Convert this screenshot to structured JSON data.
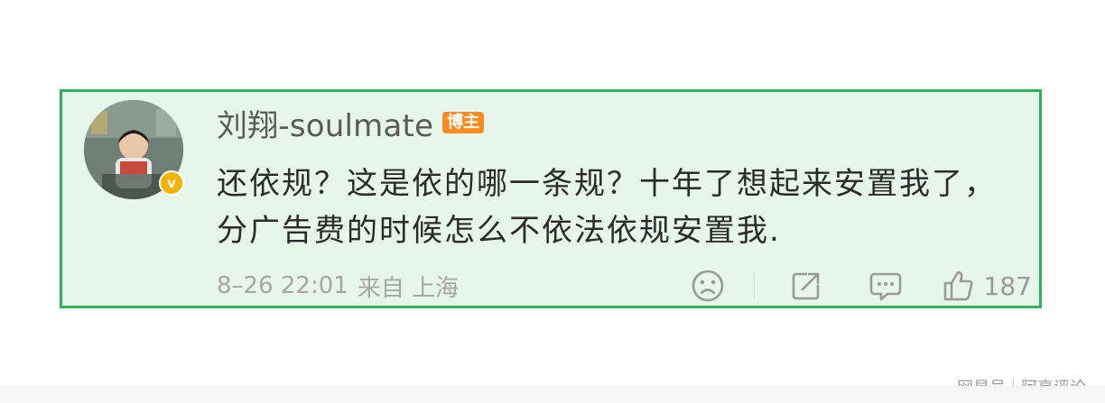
{
  "comment": {
    "username": "刘翔-soulmate",
    "author_badge": "博主",
    "verified_badge": "v",
    "avatar_icon": "user-avatar-photo",
    "text": "还依规？这是依的哪一条规？十年了想起来安置我了，分广告费的时候怎么不依法依规安置我.",
    "date": "8–26 22:01",
    "source": "来自 上海",
    "actions": {
      "emoji_icon": "sad-face-icon",
      "share_icon": "share-icon",
      "comment_icon": "comment-bubble-icon",
      "like_icon": "thumbs-up-icon",
      "like_count": "187"
    },
    "colors": {
      "highlight_border": "#2fb45c",
      "highlight_background": "#e6f6ea",
      "author_badge": "#ff8a1f",
      "verified": "#f3b400"
    }
  },
  "watermark": {
    "site": "网易号",
    "account": "阿亮评论"
  }
}
